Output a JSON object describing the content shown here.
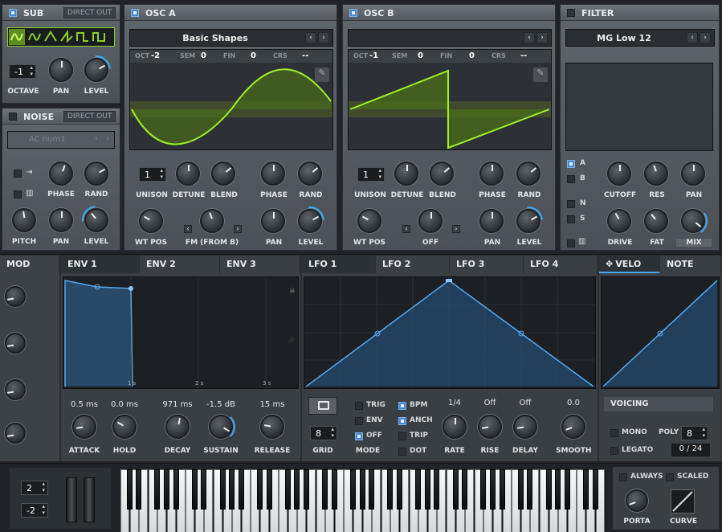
{
  "sub": {
    "title": "SUB",
    "direct_out": "DIRECT OUT",
    "octave_value": "-1",
    "labels": {
      "octave": "OCTAVE",
      "pan": "PAN",
      "level": "LEVEL"
    }
  },
  "noise": {
    "title": "NOISE",
    "direct_out": "DIRECT OUT",
    "preset": "AC hum1",
    "labels": {
      "phase": "PHASE",
      "rand": "RAND",
      "pitch": "PITCH",
      "pan": "PAN",
      "level": "LEVEL"
    }
  },
  "osc_a": {
    "title": "OSC A",
    "preset": "Basic Shapes",
    "params": [
      {
        "name": "OCT",
        "value": "-2"
      },
      {
        "name": "SEM",
        "value": "0"
      },
      {
        "name": "FIN",
        "value": "0"
      },
      {
        "name": "CRS",
        "value": "--"
      }
    ],
    "unison_value": "1",
    "labels": {
      "unison": "UNISON",
      "detune": "DETUNE",
      "blend": "BLEND",
      "phase": "PHASE",
      "rand": "RAND",
      "wt_pos": "WT POS",
      "fm": "FM (FROM B)",
      "pan": "PAN",
      "level": "LEVEL"
    }
  },
  "osc_b": {
    "title": "OSC B",
    "preset": "",
    "params": [
      {
        "name": "OCT",
        "value": "-1"
      },
      {
        "name": "SEM",
        "value": "0"
      },
      {
        "name": "FIN",
        "value": "0"
      },
      {
        "name": "CRS",
        "value": "--"
      }
    ],
    "unison_value": "1",
    "labels": {
      "unison": "UNISON",
      "detune": "DETUNE",
      "blend": "BLEND",
      "phase": "PHASE",
      "rand": "RAND",
      "wt_pos": "WT POS",
      "off": "OFF",
      "pan": "PAN",
      "level": "LEVEL"
    }
  },
  "filter": {
    "title": "FILTER",
    "preset": "MG Low 12",
    "routes": {
      "a": "A",
      "b": "B",
      "n": "N",
      "s": "S"
    },
    "labels": {
      "cutoff": "CUTOFF",
      "res": "RES",
      "pan": "PAN",
      "drive": "DRIVE",
      "fat": "FAT",
      "mix": "MIX"
    }
  },
  "mod": {
    "title": "MOD"
  },
  "env_tabs": [
    "ENV 1",
    "ENV 2",
    "ENV 3"
  ],
  "env": {
    "markers": [
      "1 s",
      "2 s",
      "3 s"
    ],
    "values": {
      "attack": "0.5 ms",
      "hold": "0.0 ms",
      "decay": "971 ms",
      "sustain": "-1.5 dB",
      "release": "15 ms"
    },
    "labels": {
      "attack": "ATTACK",
      "hold": "HOLD",
      "decay": "DECAY",
      "sustain": "SUSTAIN",
      "release": "RELEASE"
    }
  },
  "lfo_tabs": [
    "LFO 1",
    "LFO 2",
    "LFO 3",
    "LFO 4"
  ],
  "lfo": {
    "grid_value": "8",
    "grid_label": "GRID",
    "mode_label": "MODE",
    "modes": {
      "trig": "TRIG",
      "env": "ENV",
      "off": "OFF"
    },
    "sync": {
      "bpm": "BPM",
      "anch": "ANCH",
      "trip": "TRIP",
      "dot": "DOT"
    },
    "values": {
      "rate": "1/4",
      "rise": "Off",
      "delay": "Off",
      "smooth": "0.0"
    },
    "labels": {
      "rate": "RATE",
      "rise": "RISE",
      "delay": "DELAY",
      "smooth": "SMOOTH"
    }
  },
  "velo_tabs": [
    "VELO",
    "NOTE"
  ],
  "voicing": {
    "title": "VOICING",
    "mono": "MONO",
    "legato": "LEGATO",
    "poly_label": "POLY",
    "poly_value": "8",
    "voices": "0 / 24"
  },
  "keyboard": {
    "pitch_up": "2",
    "pitch_down": "-2"
  },
  "porta": {
    "always": "ALWAYS",
    "scaled": "SCALED",
    "porta": "PORTA",
    "curve": "CURVE"
  }
}
